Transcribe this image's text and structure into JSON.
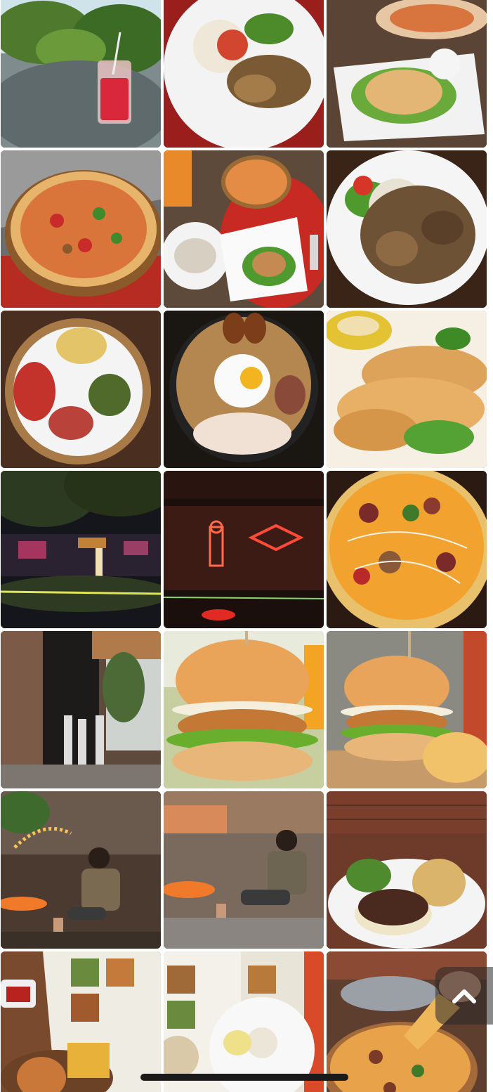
{
  "gallery": {
    "photos": [
      {
        "subject": "red-drink-on-terrace"
      },
      {
        "subject": "rice-plate-with-chicken"
      },
      {
        "subject": "calamari-and-pizza"
      },
      {
        "subject": "pizza-on-board"
      },
      {
        "subject": "table-spread-pizza-calamari"
      },
      {
        "subject": "fried-chicken-rice-plate"
      },
      {
        "subject": "rice-platter-with-sambal"
      },
      {
        "subject": "fried-rice-with-egg"
      },
      {
        "subject": "fried-calamari-rings"
      },
      {
        "subject": "night-garden-seating"
      },
      {
        "subject": "neon-sign-interior"
      },
      {
        "subject": "pizza-closeup"
      },
      {
        "subject": "brick-facade-entrance"
      },
      {
        "subject": "chicken-burger"
      },
      {
        "subject": "burger-with-fries"
      },
      {
        "subject": "man-seated-restaurant"
      },
      {
        "subject": "man-seated-patio"
      },
      {
        "subject": "steak-with-mash"
      },
      {
        "subject": "burger-fries-and-menu"
      },
      {
        "subject": "menu-and-rice-plate"
      },
      {
        "subject": "pizza-slice-lift"
      }
    ]
  },
  "controls": {
    "scroll_top_icon": "chevron-up-icon"
  }
}
